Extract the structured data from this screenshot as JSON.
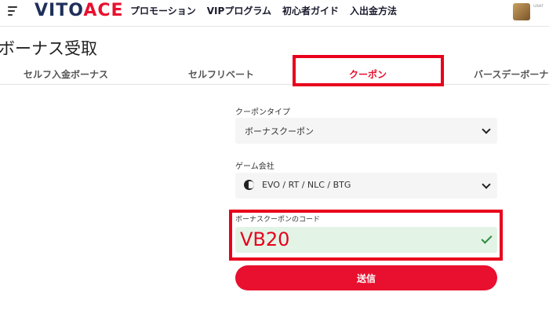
{
  "header": {
    "logo_main": "VITO",
    "logo_accent": "ACE",
    "nav": [
      "プロモーション",
      "VIPプログラム",
      "初心者ガイド",
      "入出金方法"
    ],
    "avatar_text": "user"
  },
  "page": {
    "title": "ボーナス受取"
  },
  "tabs": [
    {
      "label": "セルフ入金ボーナス",
      "active": false
    },
    {
      "label": "セルフリベート",
      "active": false
    },
    {
      "label": "クーポン",
      "active": true
    },
    {
      "label": "バースデーボーナス",
      "active": false
    }
  ],
  "form": {
    "coupon_type_label": "クーポンタイプ",
    "coupon_type_value": "ボーナスクーポン",
    "provider_label": "ゲーム会社",
    "provider_value": "EVO / RT / NLC / BTG",
    "code_label": "ボーナスクーポンのコード",
    "code_value": "VB20",
    "submit_label": "送信"
  },
  "colors": {
    "accent": "#e8102e",
    "highlight_box": "#e8001c",
    "valid_field": "#e3f4e6",
    "valid_check": "#2e8b3d"
  }
}
